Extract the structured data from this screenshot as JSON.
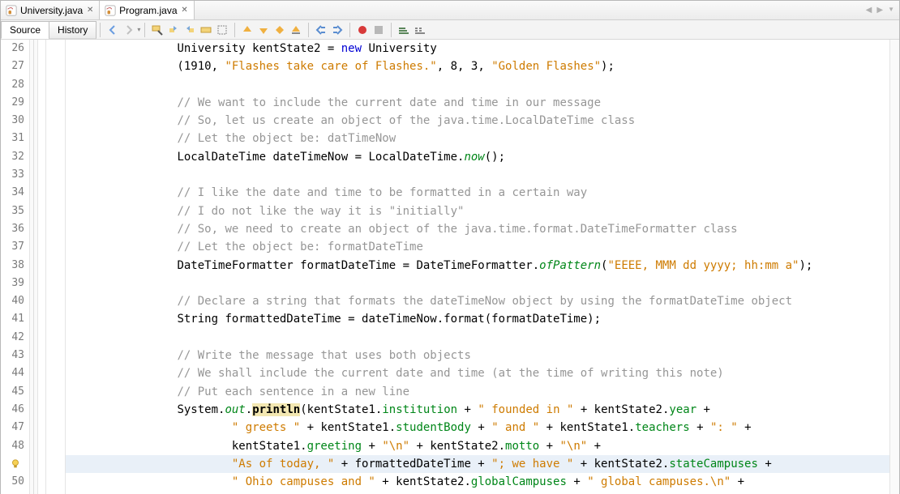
{
  "tabs": [
    {
      "label": "University.java",
      "active": false
    },
    {
      "label": "Program.java",
      "active": true
    }
  ],
  "viewTabs": {
    "source": "Source",
    "history": "History"
  },
  "firstLine": 26,
  "highlightLineIdx": 23,
  "bulbLineIdx": 23,
  "code": [
    [
      [
        "",
        "        "
      ],
      [
        "met",
        "University kentState2 = "
      ],
      [
        "kw",
        "new"
      ],
      [
        "met",
        " University"
      ]
    ],
    [
      [
        "",
        "        ("
      ],
      [
        "num",
        "1910"
      ],
      [
        "met",
        ", "
      ],
      [
        "str",
        "\"Flashes take care of Flashes.\""
      ],
      [
        "met",
        ", "
      ],
      [
        "num",
        "8"
      ],
      [
        "met",
        ", "
      ],
      [
        "num",
        "3"
      ],
      [
        "met",
        ", "
      ],
      [
        "str",
        "\"Golden Flashes\""
      ],
      [
        "met",
        ");"
      ]
    ],
    [],
    [
      [
        "",
        "        "
      ],
      [
        "cmt",
        "// We want to include the current date and time in our message"
      ]
    ],
    [
      [
        "",
        "        "
      ],
      [
        "cmt",
        "// So, let us create an object of the java.time.LocalDateTime class"
      ]
    ],
    [
      [
        "",
        "        "
      ],
      [
        "cmt",
        "// Let the object be: datTimeNow"
      ]
    ],
    [
      [
        "",
        "        "
      ],
      [
        "met",
        "LocalDateTime dateTimeNow = LocalDateTime."
      ],
      [
        "static",
        "now"
      ],
      [
        "met",
        "();"
      ]
    ],
    [],
    [
      [
        "",
        "        "
      ],
      [
        "cmt",
        "// I like the date and time to be formatted in a certain way"
      ]
    ],
    [
      [
        "",
        "        "
      ],
      [
        "cmt",
        "// I do not like the way it is \"initially\""
      ]
    ],
    [
      [
        "",
        "        "
      ],
      [
        "cmt",
        "// So, we need to create an object of the java.time.format.DateTimeFormatter class"
      ]
    ],
    [
      [
        "",
        "        "
      ],
      [
        "cmt",
        "// Let the object be: formatDateTime"
      ]
    ],
    [
      [
        "",
        "        "
      ],
      [
        "met",
        "DateTimeFormatter formatDateTime = DateTimeFormatter."
      ],
      [
        "static",
        "ofPattern"
      ],
      [
        "met",
        "("
      ],
      [
        "str",
        "\"EEEE, MMM dd yyyy; hh:mm a\""
      ],
      [
        "met",
        ");"
      ]
    ],
    [],
    [
      [
        "",
        "        "
      ],
      [
        "cmt",
        "// Declare a string that formats the dateTimeNow object by using the formatDateTime object"
      ]
    ],
    [
      [
        "",
        "        "
      ],
      [
        "met",
        "String formattedDateTime = dateTimeNow.format(formatDateTime);"
      ]
    ],
    [],
    [
      [
        "",
        "        "
      ],
      [
        "cmt",
        "// Write the message that uses both objects"
      ]
    ],
    [
      [
        "",
        "        "
      ],
      [
        "cmt",
        "// We shall include the current date and time (at the time of writing this note)"
      ]
    ],
    [
      [
        "",
        "        "
      ],
      [
        "cmt",
        "// Put each sentence in a new line"
      ]
    ],
    [
      [
        "",
        "        "
      ],
      [
        "met",
        "System."
      ],
      [
        "static",
        "out"
      ],
      [
        "met",
        "."
      ],
      [
        "hi",
        "println"
      ],
      [
        "met",
        "(kentState1."
      ],
      [
        "field",
        "institution"
      ],
      [
        "met",
        " + "
      ],
      [
        "str",
        "\" founded in \""
      ],
      [
        "met",
        " + kentState2."
      ],
      [
        "field",
        "year"
      ],
      [
        "met",
        " +"
      ]
    ],
    [
      [
        "",
        "                "
      ],
      [
        "str",
        "\" greets \""
      ],
      [
        "met",
        " + kentState1."
      ],
      [
        "field",
        "studentBody"
      ],
      [
        "met",
        " + "
      ],
      [
        "str",
        "\" and \""
      ],
      [
        "met",
        " + kentState1."
      ],
      [
        "field",
        "teachers"
      ],
      [
        "met",
        " + "
      ],
      [
        "str",
        "\": \""
      ],
      [
        "met",
        " +"
      ]
    ],
    [
      [
        "",
        "                "
      ],
      [
        "met",
        "kentState1."
      ],
      [
        "field",
        "greeting"
      ],
      [
        "met",
        " + "
      ],
      [
        "str",
        "\"\\n\""
      ],
      [
        "met",
        " + kentState2."
      ],
      [
        "field",
        "motto"
      ],
      [
        "met",
        " + "
      ],
      [
        "str",
        "\"\\n\""
      ],
      [
        "met",
        " +"
      ]
    ],
    [
      [
        "",
        "                "
      ],
      [
        "str",
        "\"As of today, \""
      ],
      [
        "met",
        " + formattedDateTime + "
      ],
      [
        "str",
        "\"; we have \""
      ],
      [
        "met",
        " + kentState2."
      ],
      [
        "field",
        "stateCampuses"
      ],
      [
        "met",
        " +"
      ]
    ],
    [
      [
        "",
        "                "
      ],
      [
        "str",
        "\" Ohio campuses and \""
      ],
      [
        "met",
        " + kentState2."
      ],
      [
        "field",
        "globalCampuses"
      ],
      [
        "met",
        " + "
      ],
      [
        "str",
        "\" global campuses.\\n\""
      ],
      [
        "met",
        " +"
      ]
    ]
  ]
}
